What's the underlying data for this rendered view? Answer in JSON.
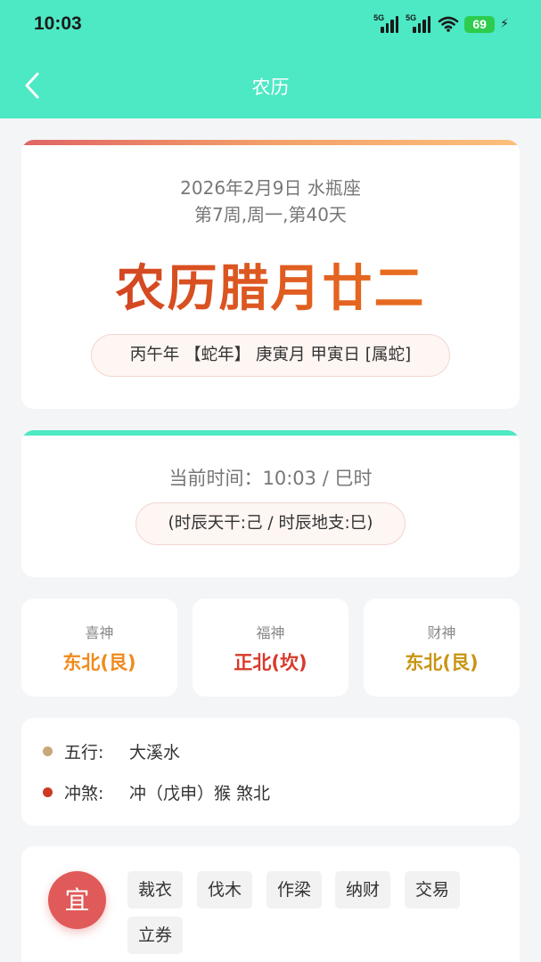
{
  "status_bar": {
    "time": "10:03",
    "signal1_label": "5G",
    "signal2_label": "5G",
    "battery": "69"
  },
  "header": {
    "title": "农历"
  },
  "date_card": {
    "date_line": "2026年2月9日 水瓶座",
    "week_line": "第7周,周一,第40天",
    "lunar_date": "农历腊月廿二",
    "ganzhi": "丙午年 【蛇年】 庚寅月 甲寅日 [属蛇]"
  },
  "time_card": {
    "current_time": "当前时间：10:03 / 巳时",
    "shichen_detail": "(时辰天干:己 / 时辰地支:巳)"
  },
  "gods": [
    {
      "label": "喜神",
      "value": "东北(艮)",
      "color": "#f08a1c"
    },
    {
      "label": "福神",
      "value": "正北(坎)",
      "color": "#d8392b"
    },
    {
      "label": "财神",
      "value": "东北(艮)",
      "color": "#c89412"
    }
  ],
  "info": {
    "wuxing_label": "五行:",
    "wuxing_value": "大溪水",
    "wuxing_dot_color": "#c9a77a",
    "chongsha_label": "冲煞:",
    "chongsha_value": "冲（戊申）猴 煞北",
    "chongsha_dot_color": "#cc3a22"
  },
  "yi": {
    "badge": "宜",
    "items": [
      "裁衣",
      "伐木",
      "作梁",
      "纳财",
      "交易",
      "立券"
    ]
  },
  "colors": {
    "header_bg": "#4de8c4",
    "accent_red": "#e05a5a"
  }
}
